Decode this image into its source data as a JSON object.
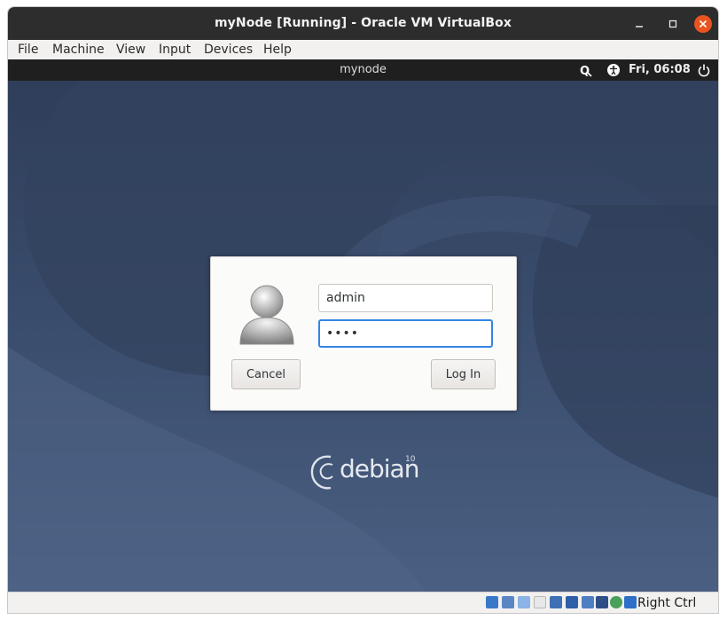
{
  "window": {
    "title": "myNode [Running] - Oracle VM VirtualBox"
  },
  "menu": {
    "items": [
      "File",
      "Machine",
      "View",
      "Input",
      "Devices",
      "Help"
    ]
  },
  "guest_topbar": {
    "hostname": "mynode",
    "clock": "Fri, 06:08"
  },
  "login": {
    "username": "admin",
    "password_masked": "••••",
    "cancel_label": "Cancel",
    "login_label": "Log In"
  },
  "branding": {
    "wordmark": "debian",
    "version": "10"
  },
  "statusbar": {
    "host_key": "Right Ctrl"
  },
  "colors": {
    "titlebar": "#2d2d2d",
    "close_button": "#e95420",
    "focus_ring": "#3584e4",
    "desktop": "#3a4d6d"
  }
}
